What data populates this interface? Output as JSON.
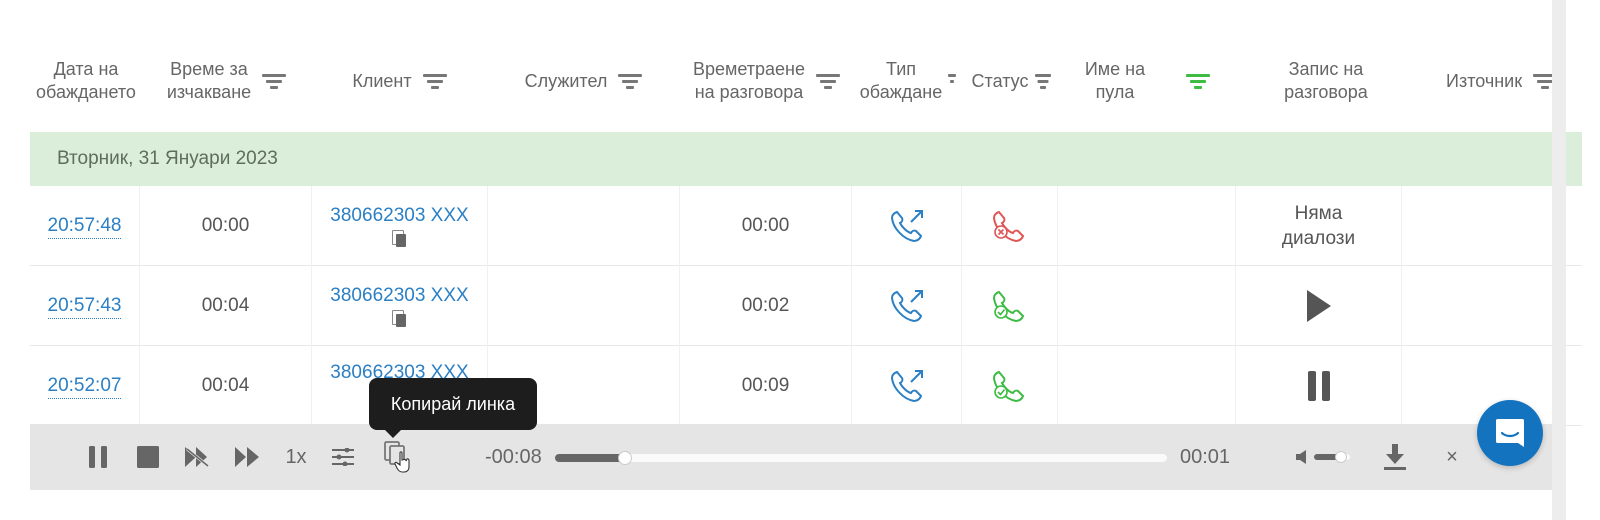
{
  "columns": [
    {
      "label": "Дата на\nобаждането",
      "filter": false
    },
    {
      "label": "Време за\nизчакване",
      "filter": true
    },
    {
      "label": "Клиент",
      "filter": true
    },
    {
      "label": "Служител",
      "filter": true
    },
    {
      "label": "Времетраене\nна разговора",
      "filter": true
    },
    {
      "label": "Тип\nобаждане",
      "filter": true
    },
    {
      "label": "Статус",
      "filter": true
    },
    {
      "label": "Име на\nпула",
      "filter": true,
      "active": true
    },
    {
      "label": "Запис на\nразговора",
      "filter": false
    },
    {
      "label": "Източник",
      "filter": true
    }
  ],
  "group_label": "Вторник, 31 Януари 2023",
  "rows": [
    {
      "time": "20:57:48",
      "wait": "00:00",
      "client": "380662303 XXX",
      "duration": "00:00",
      "type_icon": "outgoing-call-icon",
      "status_icon": "missed-call-icon",
      "record": "Няма\nдиалози"
    },
    {
      "time": "20:57:43",
      "wait": "00:04",
      "client": "380662303 XXX",
      "duration": "00:02",
      "type_icon": "outgoing-call-icon",
      "status_icon": "answered-call-icon",
      "record_icon": "play-icon"
    },
    {
      "time": "20:52:07",
      "wait": "00:04",
      "client": "380662303 XXX",
      "duration": "00:09",
      "type_icon": "outgoing-call-icon",
      "status_icon": "answered-call-icon",
      "record_icon": "pause-icon"
    }
  ],
  "player": {
    "speed": "1x",
    "elapsed": "-00:08",
    "remaining": "00:01",
    "progress_fraction": 0.115,
    "volume_fraction": 0.75,
    "close": "×"
  },
  "tooltip": "Копирай линка",
  "colors": {
    "link": "#2b7fc4",
    "group_bg": "#daeeda",
    "answered": "#3dbb43",
    "missed": "#e05555",
    "active_filter": "#3dbb43",
    "chat": "#1473bf"
  }
}
